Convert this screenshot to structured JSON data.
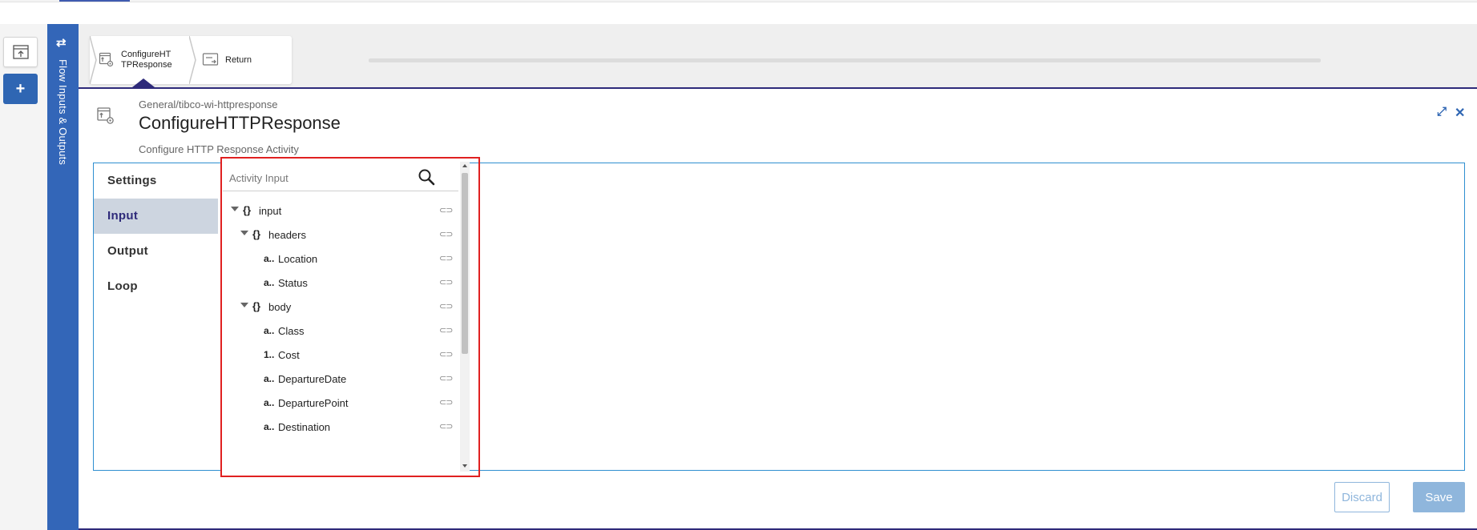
{
  "sidebar": {
    "flow_label": "Flow Inputs & Outputs",
    "add_label": "+"
  },
  "breadcrumb": {
    "steps": [
      {
        "label": "ConfigureHT\nTPResponse",
        "icon": "http-response-icon"
      },
      {
        "label": "Return",
        "icon": "return-icon"
      }
    ]
  },
  "activity": {
    "path": "General/tibco-wi-httpresponse",
    "title": "ConfigureHTTPResponse",
    "description": "Configure HTTP Response Activity"
  },
  "tabs": [
    {
      "label": "Settings"
    },
    {
      "label": "Input"
    },
    {
      "label": "Output"
    },
    {
      "label": "Loop"
    }
  ],
  "tree": {
    "search_placeholder": "Activity Input",
    "items": [
      {
        "type": "{}",
        "name": "input",
        "level": 0,
        "expandable": true
      },
      {
        "type": "{}",
        "name": "headers",
        "level": 1,
        "expandable": true
      },
      {
        "type": "a..",
        "name": "Location",
        "level": 2,
        "expandable": false
      },
      {
        "type": "a..",
        "name": "Status",
        "level": 2,
        "expandable": false
      },
      {
        "type": "{}",
        "name": "body",
        "level": 1,
        "expandable": true
      },
      {
        "type": "a..",
        "name": "Class",
        "level": 2,
        "expandable": false
      },
      {
        "type": "1..",
        "name": "Cost",
        "level": 2,
        "expandable": false
      },
      {
        "type": "a..",
        "name": "DepartureDate",
        "level": 2,
        "expandable": false
      },
      {
        "type": "a..",
        "name": "DeparturePoint",
        "level": 2,
        "expandable": false
      },
      {
        "type": "a..",
        "name": "Destination",
        "level": 2,
        "expandable": false
      }
    ],
    "link_glyph": "⊂⊃"
  },
  "buttons": {
    "discard": "Discard",
    "save": "Save"
  },
  "colors": {
    "accent": "#3366b8",
    "active_tab_bg": "#cdd5e0",
    "highlight": "#e02020",
    "button_disabled": "#8fb6dc"
  }
}
